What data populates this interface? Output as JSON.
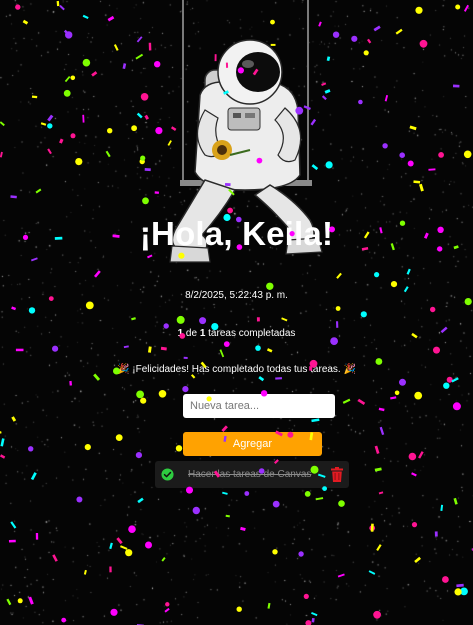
{
  "greeting": "¡Hola, Keila!",
  "datetime": "8/2/2025, 5:22:43 p. m.",
  "progress": {
    "completed": "1",
    "of_text": " de ",
    "total": "1",
    "suffix": " tareas completadas"
  },
  "congrats": "🎉 ¡Felicidades! Has completado todas tus tareas. 🎉",
  "task_input": {
    "placeholder": "Nueva tarea...",
    "value": ""
  },
  "add_button": {
    "label": "Agregar"
  },
  "tasks": [
    {
      "text": "Hacer las tareas de Canvas",
      "completed": true
    }
  ],
  "icons": {
    "complete": "check-circle-icon",
    "delete": "trash-icon"
  },
  "colors": {
    "background": "#050505",
    "accent": "#ffa201",
    "task_bg": "#1b1b1b",
    "check": "#2ecc40",
    "trash": "#e31b23",
    "confetti": [
      "#ffff00",
      "#ff00ff",
      "#00ffff",
      "#9b30ff",
      "#7fff00",
      "#ff1493"
    ]
  }
}
